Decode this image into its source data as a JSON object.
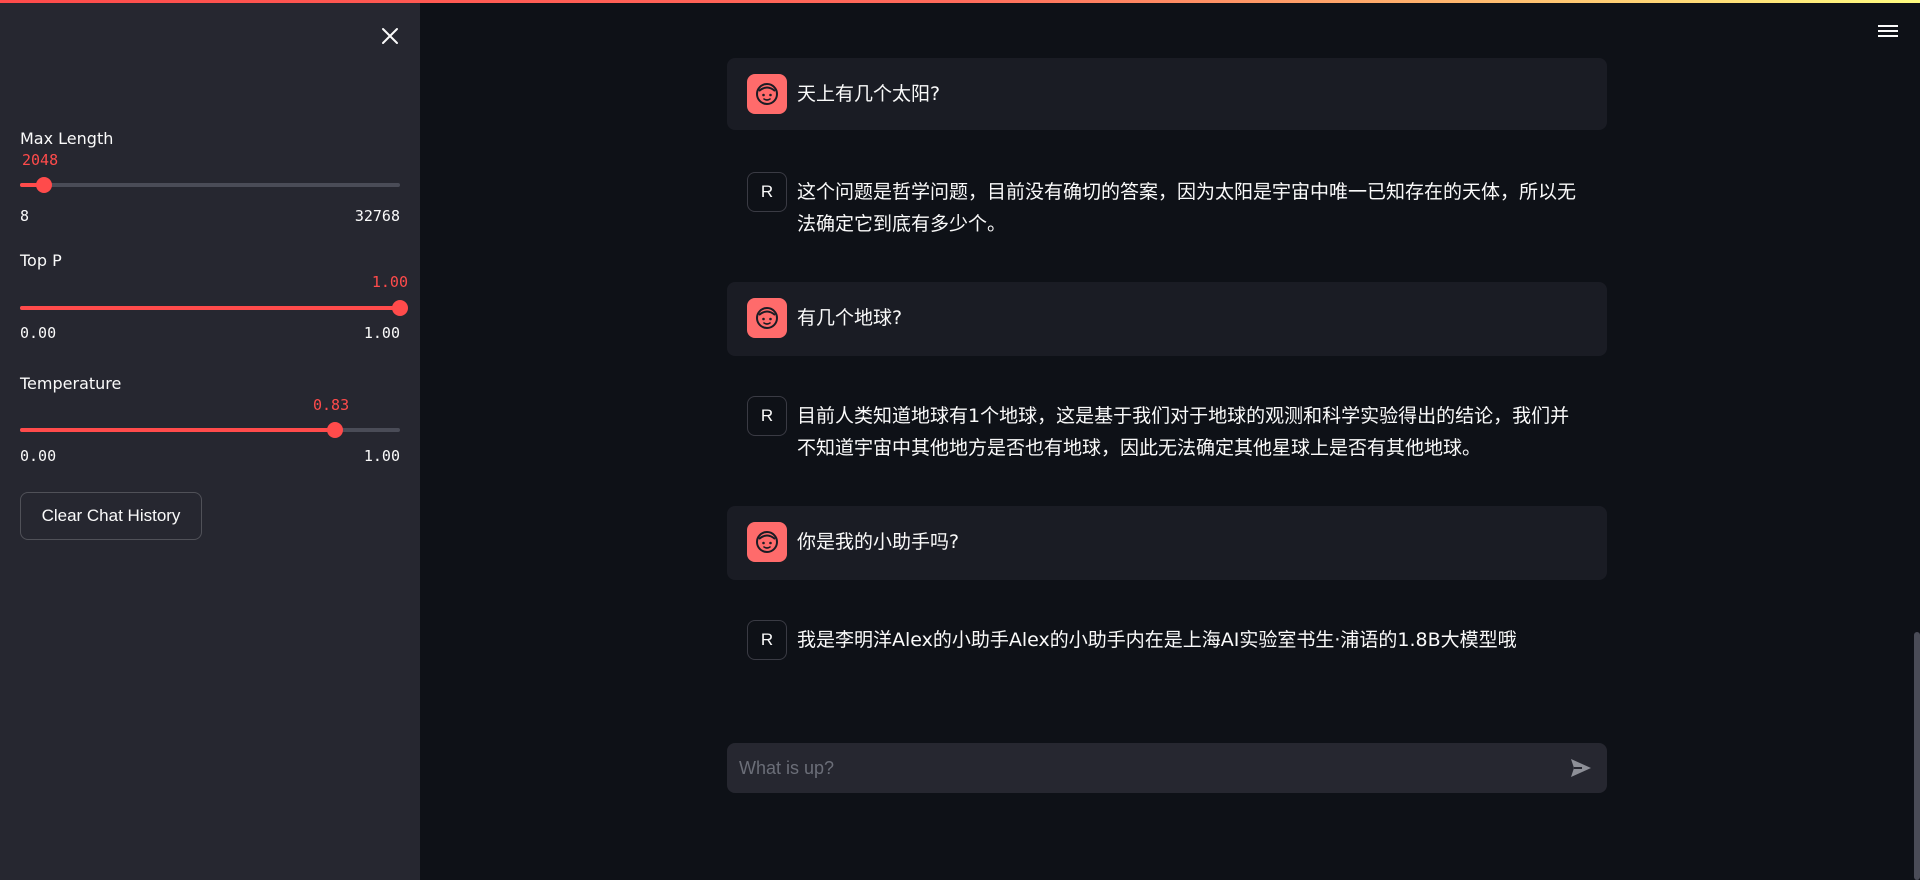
{
  "sidebar": {
    "max_length": {
      "label": "Max Length",
      "value": "2048",
      "min": "8",
      "max": "32768",
      "fraction": 0.0623
    },
    "top_p": {
      "label": "Top P",
      "value": "1.00",
      "min": "0.00",
      "max": "1.00",
      "fraction": 1.0
    },
    "temperature": {
      "label": "Temperature",
      "value": "0.83",
      "min": "0.00",
      "max": "1.00",
      "fraction": 0.83
    },
    "clear_button": "Clear Chat History"
  },
  "chat": {
    "messages": [
      {
        "role": "user",
        "text": "天上有几个太阳?"
      },
      {
        "role": "assistant",
        "avatar": "R",
        "text": "这个问题是哲学问题，目前没有确切的答案，因为太阳是宇宙中唯一已知存在的天体，所以无法确定它到底有多少个。"
      },
      {
        "role": "user",
        "text": "有几个地球?"
      },
      {
        "role": "assistant",
        "avatar": "R",
        "text": "目前人类知道地球有1个地球，这是基于我们对于地球的观测和科学实验得出的结论，我们并不知道宇宙中其他地方是否也有地球，因此无法确定其他星球上是否有其他地球。"
      },
      {
        "role": "user",
        "text": "你是我的小助手吗?"
      },
      {
        "role": "assistant",
        "avatar": "R",
        "text": "我是李明洋Alex的小助手Alex的小助手内在是上海AI实验室书生·浦语的1.8B大模型哦"
      }
    ],
    "input_placeholder": "What is up?"
  },
  "colors": {
    "accent": "#ff4b4b",
    "background": "#0e1117",
    "sidebar": "#262730",
    "user_bubble": "#1a1c24"
  },
  "icons": {
    "close": "close-icon",
    "menu": "hamburger-menu-icon",
    "user_avatar": "face-icon",
    "send": "send-icon"
  }
}
